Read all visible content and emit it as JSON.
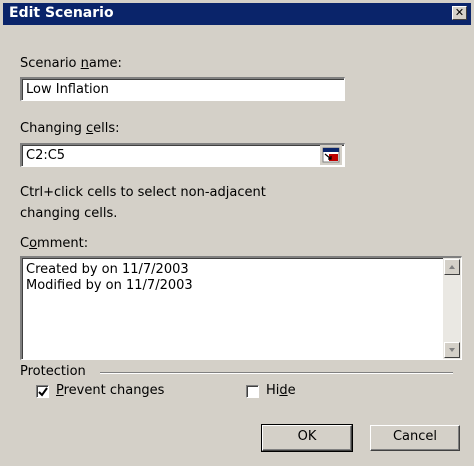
{
  "window": {
    "title": "Edit Scenario",
    "close_glyph": "✕"
  },
  "scenario_name": {
    "label": "Scenario name:",
    "value": "Low Inflation"
  },
  "changing_cells": {
    "label": "Changing cells:",
    "value": "C2:C5"
  },
  "hint": {
    "line1": "Ctrl+click cells to select non-adjacent",
    "line2": "changing cells."
  },
  "comment": {
    "label": "Comment:",
    "line1": "Created by on 11/7/2003",
    "line2": "Modified by on 11/7/2003"
  },
  "protection": {
    "label": "Protection",
    "prevent_changes": {
      "label": "Prevent changes",
      "checked": true
    },
    "hide": {
      "label": "Hide",
      "checked": false
    }
  },
  "buttons": {
    "ok": "OK",
    "cancel": "Cancel"
  },
  "colors": {
    "titlebar": "#0a246a",
    "face": "#d4d0c8"
  }
}
